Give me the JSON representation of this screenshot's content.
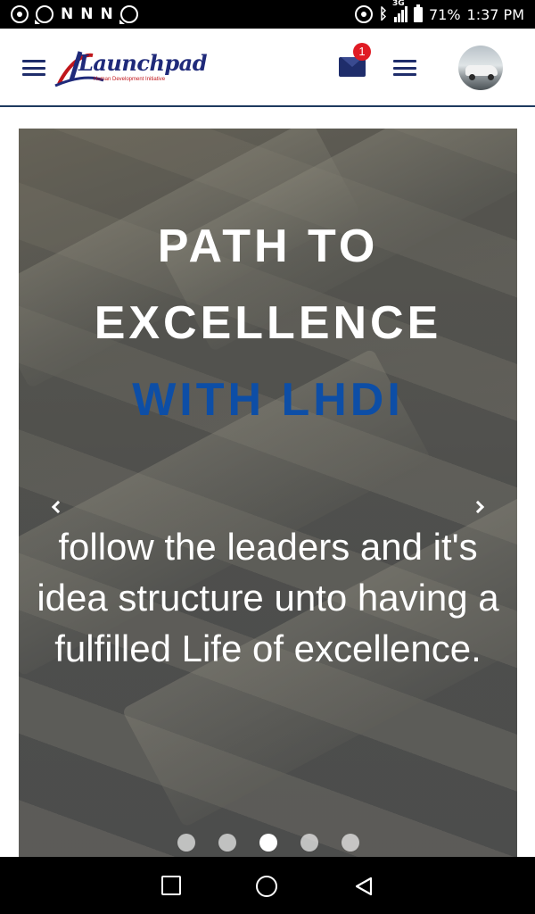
{
  "status_bar": {
    "network": "3G",
    "battery": "71%",
    "time": "1:37 PM",
    "notification_icons": [
      "chrome-icon",
      "whatsapp-icon",
      "n-icon",
      "n-icon",
      "n-icon",
      "whatsapp-icon"
    ]
  },
  "header": {
    "logo_text": "Launchpad",
    "logo_subtitle": "Human Development Initiative",
    "mail_badge": "1"
  },
  "hero": {
    "title_line1": "PATH TO",
    "title_line2": "EXCELLENCE",
    "title_line3": "WITH LHDI",
    "title_accent_color": "#0d4ea6",
    "description": "follow the leaders and it's idea structure unto having a fulfilled Life of excellence.",
    "slide_count": 5,
    "active_slide": 3
  }
}
